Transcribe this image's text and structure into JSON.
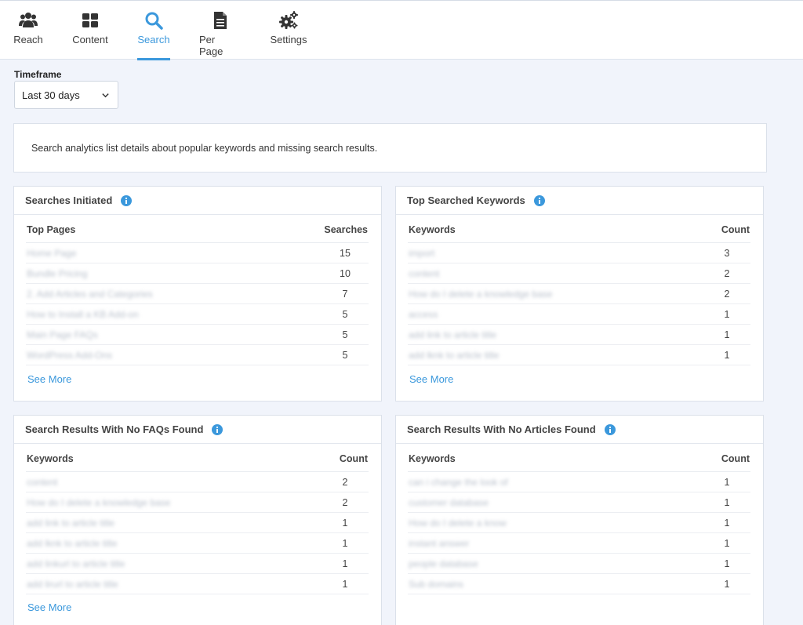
{
  "nav": {
    "tabs": [
      {
        "label": "Reach",
        "icon": "users-icon"
      },
      {
        "label": "Content",
        "icon": "grid-icon"
      },
      {
        "label": "Search",
        "icon": "search-icon",
        "active": true
      },
      {
        "label": "Per Page",
        "icon": "document-icon"
      },
      {
        "label": "Settings",
        "icon": "gears-icon"
      }
    ]
  },
  "timeframe": {
    "label": "Timeframe",
    "selected": "Last 30 days"
  },
  "intro": "Search analytics list details about popular keywords and missing search results.",
  "colors": {
    "accent": "#3b98dc",
    "background": "#f1f4fb"
  },
  "panels": [
    {
      "title": "Searches Initiated",
      "col1": "Top Pages",
      "col2": "Searches",
      "rows": [
        {
          "name": "Home Page",
          "value": "15"
        },
        {
          "name": "Bundle Pricing",
          "value": "10"
        },
        {
          "name": "2. Add Articles and Categories",
          "value": "7"
        },
        {
          "name": "How to Install a KB Add-on",
          "value": "5"
        },
        {
          "name": "Main Page FAQs",
          "value": "5"
        },
        {
          "name": "WordPress Add-Ons",
          "value": "5"
        }
      ],
      "see_more": "See More"
    },
    {
      "title": "Top Searched Keywords",
      "col1": "Keywords",
      "col2": "Count",
      "rows": [
        {
          "name": "import",
          "value": "3"
        },
        {
          "name": "content",
          "value": "2"
        },
        {
          "name": "How do I delete a knowledge base",
          "value": "2"
        },
        {
          "name": "access",
          "value": "1"
        },
        {
          "name": "add link to article title",
          "value": "1"
        },
        {
          "name": "add lknk to article title",
          "value": "1"
        }
      ],
      "see_more": "See More"
    },
    {
      "title": "Search Results With No FAQs Found",
      "col1": "Keywords",
      "col2": "Count",
      "rows": [
        {
          "name": "content",
          "value": "2"
        },
        {
          "name": "How do I delete a knowledge base",
          "value": "2"
        },
        {
          "name": "add link to article title",
          "value": "1"
        },
        {
          "name": "add lknk to article title",
          "value": "1"
        },
        {
          "name": "add linkurl to article title",
          "value": "1"
        },
        {
          "name": "add lirurl to article title",
          "value": "1"
        }
      ],
      "see_more": "See More"
    },
    {
      "title": "Search Results With No Articles Found",
      "col1": "Keywords",
      "col2": "Count",
      "rows": [
        {
          "name": "can i change the look of",
          "value": "1"
        },
        {
          "name": "customer database",
          "value": "1"
        },
        {
          "name": "How do I delete a know",
          "value": "1"
        },
        {
          "name": "instant answer",
          "value": "1"
        },
        {
          "name": "people database",
          "value": "1"
        },
        {
          "name": "Sub domains",
          "value": "1"
        }
      ]
    }
  ]
}
